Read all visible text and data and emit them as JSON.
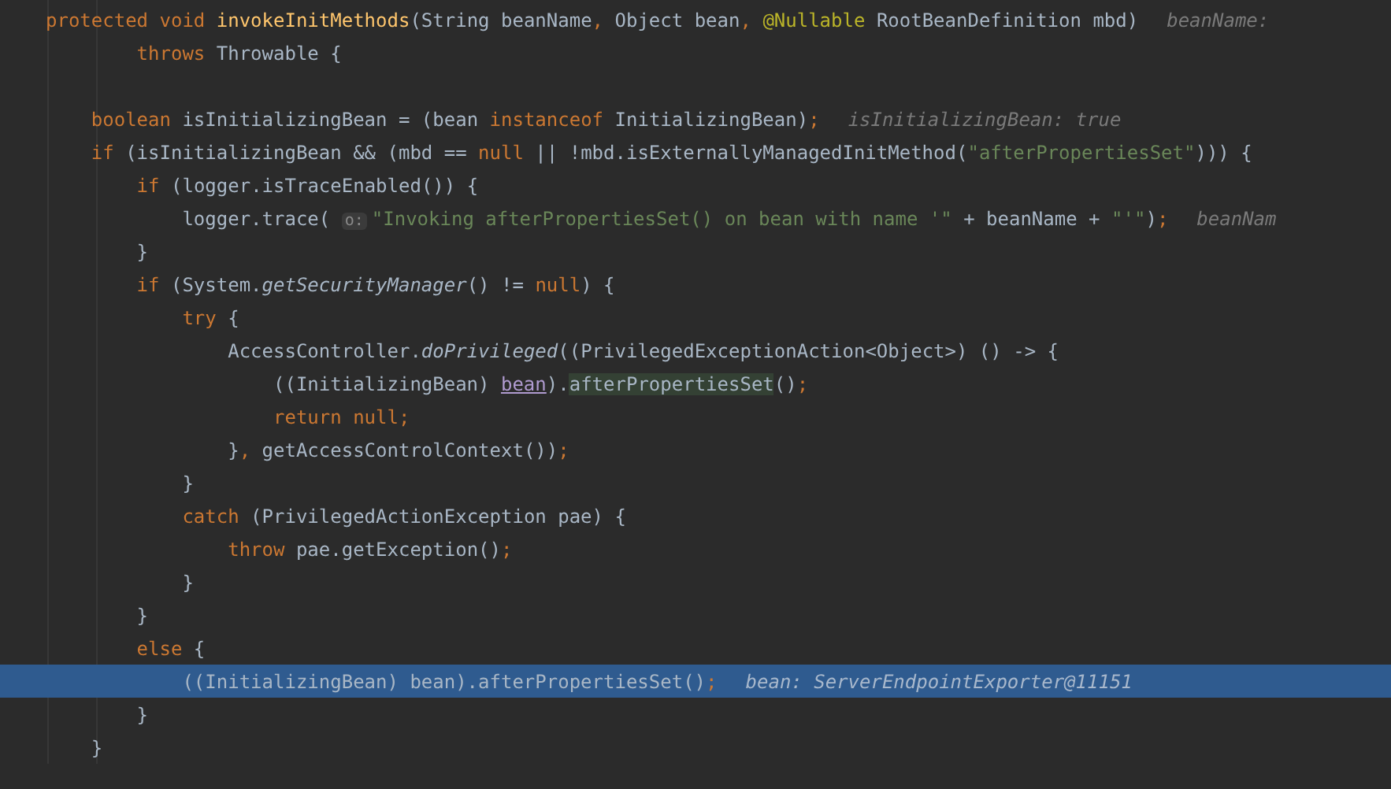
{
  "editor": {
    "lines": [
      {
        "tokens": [
          {
            "kind": "keyword",
            "text": "protected void "
          },
          {
            "kind": "declaration",
            "text": "invokeInitMethods"
          },
          {
            "kind": "plain",
            "text": "(String beanName"
          },
          {
            "kind": "keyword",
            "text": ", "
          },
          {
            "kind": "plain",
            "text": "Object bean"
          },
          {
            "kind": "keyword",
            "text": ", "
          },
          {
            "kind": "annotation",
            "text": "@Nullable "
          },
          {
            "kind": "plain",
            "text": "RootBeanDefinition mbd)"
          }
        ],
        "hint": "beanName:",
        "current": false
      },
      {
        "tokens": [
          {
            "kind": "keyword",
            "text": "        throws "
          },
          {
            "kind": "plain",
            "text": "Throwable {"
          }
        ],
        "current": false
      },
      {
        "current": false
      },
      {
        "tokens": [
          {
            "kind": "keyword",
            "text": "    boolean "
          },
          {
            "kind": "plain",
            "text": "isInitializingBean = (bean "
          },
          {
            "kind": "keyword",
            "text": "instanceof "
          },
          {
            "kind": "plain",
            "text": "InitializingBean)"
          },
          {
            "kind": "keyword",
            "text": ";"
          }
        ],
        "hint": "isInitializingBean: true",
        "current": false
      },
      {
        "tokens": [
          {
            "kind": "keyword",
            "text": "    if "
          },
          {
            "kind": "plain",
            "text": "(isInitializingBean && (mbd == "
          },
          {
            "kind": "keyword",
            "text": "null "
          },
          {
            "kind": "plain",
            "text": "|| !mbd.isExternallyManagedInitMethod("
          },
          {
            "kind": "string",
            "text": "\"afterPropertiesSet\""
          },
          {
            "kind": "plain",
            "text": "))) {"
          }
        ],
        "current": false
      },
      {
        "tokens": [
          {
            "kind": "keyword",
            "text": "        if "
          },
          {
            "kind": "plain",
            "text": "("
          },
          {
            "kind": "field",
            "text": "logger"
          },
          {
            "kind": "plain",
            "text": ".isTraceEnabled()) {"
          }
        ],
        "current": false
      },
      {
        "tokens": [
          {
            "kind": "field",
            "text": "            logger"
          },
          {
            "kind": "plain",
            "text": ".trace( "
          },
          {
            "kind": "param_hint",
            "text": "o:"
          },
          {
            "kind": "string",
            "text": "\"Invoking afterPropertiesSet() on bean with name '\""
          },
          {
            "kind": "plain",
            "text": " + beanName + "
          },
          {
            "kind": "string",
            "text": "\"'\""
          },
          {
            "kind": "plain",
            "text": ")"
          },
          {
            "kind": "keyword",
            "text": ";"
          }
        ],
        "hint": "beanNam",
        "current": false
      },
      {
        "tokens": [
          {
            "kind": "plain",
            "text": "        }"
          }
        ],
        "current": false
      },
      {
        "tokens": [
          {
            "kind": "keyword",
            "text": "        if "
          },
          {
            "kind": "plain",
            "text": "(System."
          },
          {
            "kind": "static",
            "text": "getSecurityManager"
          },
          {
            "kind": "plain",
            "text": "() != "
          },
          {
            "kind": "keyword",
            "text": "null"
          },
          {
            "kind": "plain",
            "text": ") {"
          }
        ],
        "current": false
      },
      {
        "tokens": [
          {
            "kind": "keyword",
            "text": "            try "
          },
          {
            "kind": "plain",
            "text": "{"
          }
        ],
        "current": false
      },
      {
        "tokens": [
          {
            "kind": "plain",
            "text": "                AccessController."
          },
          {
            "kind": "static",
            "text": "doPrivileged"
          },
          {
            "kind": "plain",
            "text": "((PrivilegedExceptionAction<Object>) () -> {"
          }
        ],
        "current": false
      },
      {
        "tokens": [
          {
            "kind": "plain",
            "text": "                    ((InitializingBean) "
          },
          {
            "kind": "usage",
            "text": "bean"
          },
          {
            "kind": "plain",
            "text": ")."
          },
          {
            "kind": "match",
            "text": "afterPropertiesSet"
          },
          {
            "kind": "plain",
            "text": "()"
          },
          {
            "kind": "keyword",
            "text": ";"
          }
        ],
        "current": false
      },
      {
        "tokens": [
          {
            "kind": "keyword",
            "text": "                    return null;"
          }
        ],
        "current": false
      },
      {
        "tokens": [
          {
            "kind": "plain",
            "text": "                }"
          },
          {
            "kind": "keyword",
            "text": ", "
          },
          {
            "kind": "plain",
            "text": "getAccessControlContext())"
          },
          {
            "kind": "keyword",
            "text": ";"
          }
        ],
        "current": false
      },
      {
        "tokens": [
          {
            "kind": "plain",
            "text": "            }"
          }
        ],
        "current": false
      },
      {
        "tokens": [
          {
            "kind": "keyword",
            "text": "            catch "
          },
          {
            "kind": "plain",
            "text": "(PrivilegedActionException pae) {"
          }
        ],
        "current": false
      },
      {
        "tokens": [
          {
            "kind": "keyword",
            "text": "                throw "
          },
          {
            "kind": "plain",
            "text": "pae.getException()"
          },
          {
            "kind": "keyword",
            "text": ";"
          }
        ],
        "current": false
      },
      {
        "tokens": [
          {
            "kind": "plain",
            "text": "            }"
          }
        ],
        "current": false
      },
      {
        "tokens": [
          {
            "kind": "plain",
            "text": "        }"
          }
        ],
        "current": false
      },
      {
        "tokens": [
          {
            "kind": "keyword",
            "text": "        else "
          },
          {
            "kind": "plain",
            "text": "{"
          }
        ],
        "current": false
      },
      {
        "tokens": [
          {
            "kind": "plain",
            "text": "            ((InitializingBean) bean).afterPropertiesSet()"
          },
          {
            "kind": "keyword",
            "text": ";"
          }
        ],
        "hint": "bean: ServerEndpointExporter@11151",
        "current": true
      },
      {
        "tokens": [
          {
            "kind": "plain",
            "text": "        }"
          }
        ],
        "current": false
      },
      {
        "tokens": [
          {
            "kind": "plain",
            "text": "    }"
          }
        ],
        "current": false
      }
    ]
  }
}
